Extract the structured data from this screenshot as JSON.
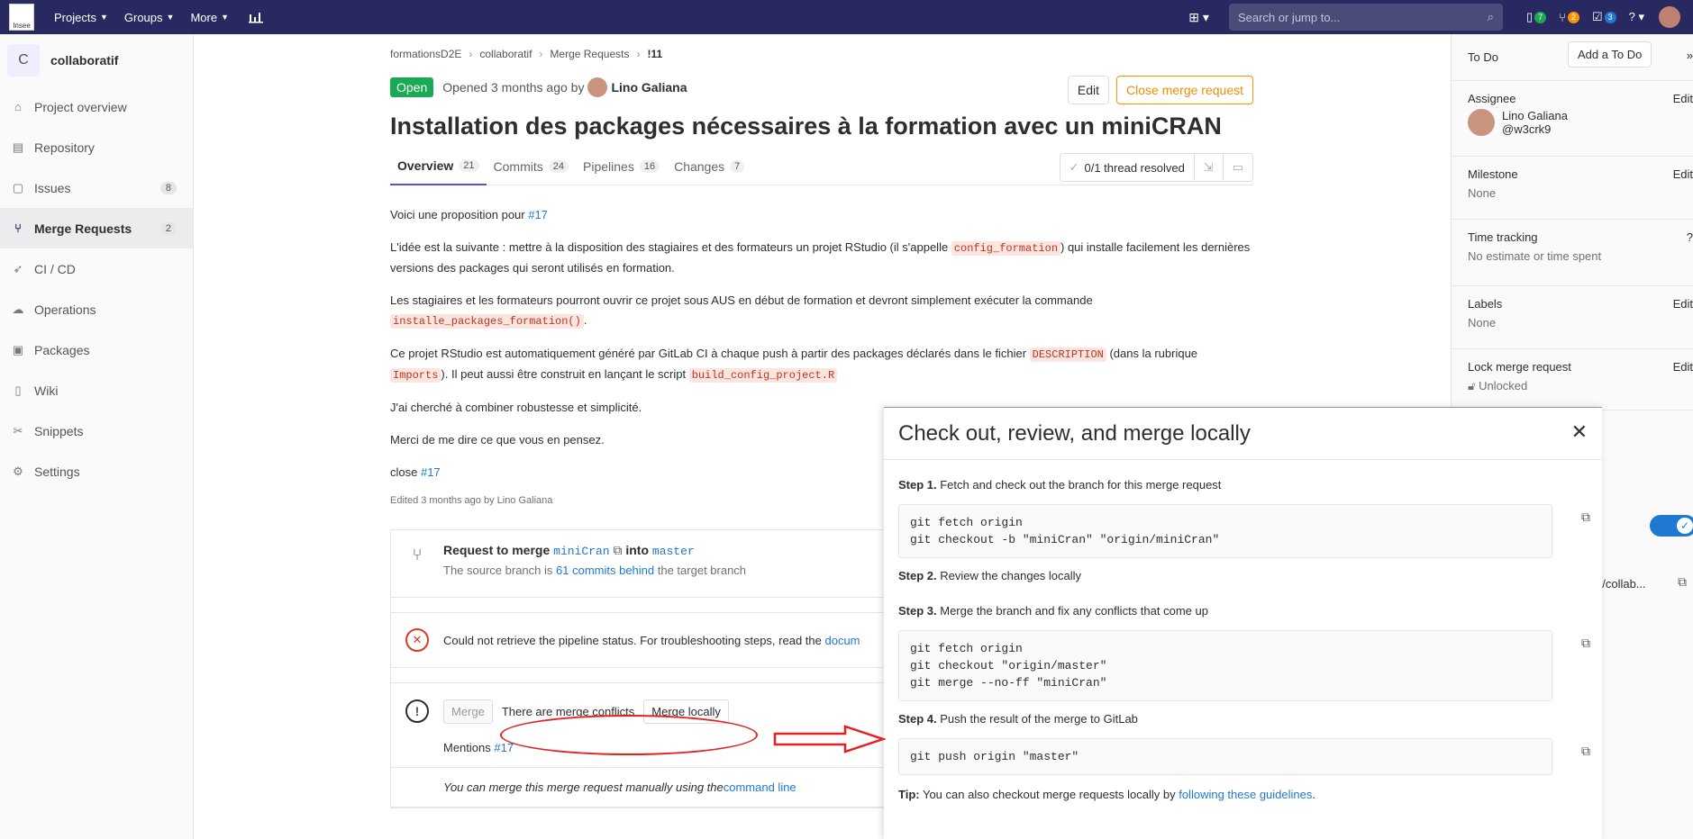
{
  "navbar": {
    "logo_text": "Insee",
    "items": [
      {
        "label": "Projects"
      },
      {
        "label": "Groups"
      },
      {
        "label": "More"
      }
    ],
    "search_placeholder": "Search or jump to...",
    "counts": {
      "issues": "7",
      "merge_requests": "2",
      "todos": "3"
    }
  },
  "sidebar": {
    "project_initial": "C",
    "project_name": "collaboratif",
    "items": [
      {
        "label": "Project overview",
        "icon": "home-icon"
      },
      {
        "label": "Repository",
        "icon": "doc-icon"
      },
      {
        "label": "Issues",
        "icon": "issues-icon",
        "count": "8"
      },
      {
        "label": "Merge Requests",
        "icon": "merge-icon",
        "count": "2"
      },
      {
        "label": "CI / CD",
        "icon": "rocket-icon"
      },
      {
        "label": "Operations",
        "icon": "cloud-icon"
      },
      {
        "label": "Packages",
        "icon": "package-icon"
      },
      {
        "label": "Wiki",
        "icon": "book-icon"
      },
      {
        "label": "Snippets",
        "icon": "scissors-icon"
      },
      {
        "label": "Settings",
        "icon": "gear-icon"
      }
    ]
  },
  "breadcrumb": [
    "formationsD2E",
    "collaboratif",
    "Merge Requests",
    "!11"
  ],
  "mr": {
    "status": "Open",
    "opened_text": "Opened 3 months ago by",
    "author": "Lino Galiana",
    "edit_label": "Edit",
    "close_label": "Close merge request",
    "title": "Installation des packages nécessaires à la formation avec un miniCRAN",
    "tabs": [
      {
        "label": "Overview",
        "count": "21"
      },
      {
        "label": "Commits",
        "count": "24"
      },
      {
        "label": "Pipelines",
        "count": "16"
      },
      {
        "label": "Changes",
        "count": "7"
      }
    ],
    "threads": "0/1 thread resolved",
    "desc": {
      "p1_text": "Voici une proposition pour ",
      "p1_link": "#17",
      "p2_a": "L'idée est la suivante : mettre à la disposition des stagiaires et des formateurs un projet RStudio (il s'appelle ",
      "p2_code": "config_formation",
      "p2_b": ") qui installe facilement les dernières versions des packages qui seront utilisés en formation.",
      "p3_a": "Les stagiaires et les formateurs pourront ouvrir ce projet sous AUS en début de formation et devront simplement exécuter la commande ",
      "p3_code": "installe_packages_formation()",
      "p3_b": ".",
      "p4_a": "Ce projet RStudio est automatiquement généré par GitLab CI à chaque push à partir des packages déclarés dans le fichier ",
      "p4_code1": "DESCRIPTION",
      "p4_b": " (dans la rubrique ",
      "p4_code2": "Imports",
      "p4_c": "). Il peut aussi être construit en lançant le script ",
      "p4_code3": "build_config_project.R",
      "p5": "J'ai cherché à combiner robustesse et simplicité.",
      "p6": "Merci de me dire ce que vous en pensez.",
      "p7_text": "close ",
      "p7_link": "#17"
    },
    "edited": "Edited 3 months ago by Lino Galiana"
  },
  "widget": {
    "request_label": "Request to merge",
    "source_branch": "miniCran",
    "into_label": "into",
    "target_branch": "master",
    "behind_a": "The source branch is ",
    "behind_link": "61 commits behind",
    "behind_b": " the target branch",
    "pipeline_a": "Could not retrieve the pipeline status. For troubleshooting steps, read the ",
    "pipeline_link": "docum",
    "merge_label": "Merge",
    "conflicts_label": "There are merge conflicts",
    "merge_locally_label": "Merge locally",
    "mentions_text": "Mentions ",
    "mentions_link": "#17",
    "manual_a": "You can merge this merge request manually using the ",
    "manual_link": "command line"
  },
  "rsidebar": {
    "todo_label": "To Do",
    "add_todo": "Add a To Do",
    "assignee_label": "Assignee",
    "assignee_name": "Lino Galiana",
    "assignee_handle": "@w3crk9",
    "edit": "Edit",
    "milestone_label": "Milestone",
    "milestone_value": "None",
    "time_label": "Time tracking",
    "time_value": "No estimate or time spent",
    "labels_label": "Labels",
    "labels_value": "None",
    "lock_label": "Lock merge request",
    "lock_value": "Unlocked",
    "ref_value": "e/collab..."
  },
  "modal": {
    "title": "Check out, review, and merge locally",
    "step1_b": "Step 1.",
    "step1": " Fetch and check out the branch for this merge request",
    "code1": "git fetch origin\ngit checkout -b \"miniCran\" \"origin/miniCran\"",
    "step2_b": "Step 2.",
    "step2": " Review the changes locally",
    "step3_b": "Step 3.",
    "step3": " Merge the branch and fix any conflicts that come up",
    "code3": "git fetch origin\ngit checkout \"origin/master\"\ngit merge --no-ff \"miniCran\"",
    "step4_b": "Step 4.",
    "step4": " Push the result of the merge to GitLab",
    "code4": "git push origin \"master\"",
    "tip_b": "Tip:",
    "tip_a": " You can also checkout merge requests locally by ",
    "tip_link": "following these guidelines",
    "tip_c": "."
  }
}
